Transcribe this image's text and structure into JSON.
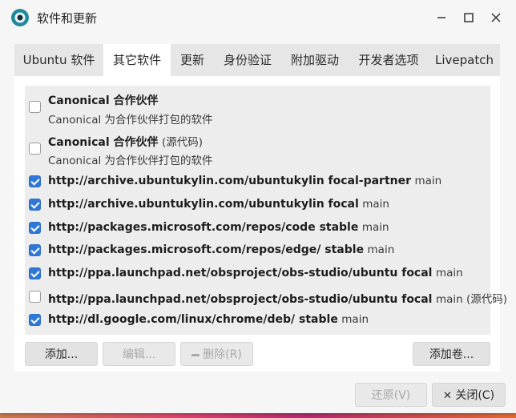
{
  "window": {
    "title": "软件和更新"
  },
  "tabs": [
    {
      "label": "Ubuntu 软件"
    },
    {
      "label": "其它软件"
    },
    {
      "label": "更新"
    },
    {
      "label": "身份验证"
    },
    {
      "label": "附加驱动"
    },
    {
      "label": "开发者选项"
    },
    {
      "label": "Livepatch"
    }
  ],
  "active_tab": "其它软件",
  "sources": [
    {
      "checked": false,
      "title": "Canonical 合作伙伴",
      "suffix": "",
      "subtitle": "Canonical 为合作伙伴打包的软件"
    },
    {
      "checked": false,
      "title": "Canonical 合作伙伴",
      "suffix": "(源代码)",
      "subtitle": "Canonical 为合作伙伴打包的软件"
    },
    {
      "checked": true,
      "title": "http://archive.ubuntukylin.com/ubuntukylin focal-partner",
      "suffix": "main"
    },
    {
      "checked": true,
      "title": "http://archive.ubuntukylin.com/ubuntukylin focal",
      "suffix": "main"
    },
    {
      "checked": true,
      "title": "http://packages.microsoft.com/repos/code stable",
      "suffix": "main"
    },
    {
      "checked": true,
      "title": "http://packages.microsoft.com/repos/edge/ stable",
      "suffix": "main"
    },
    {
      "checked": true,
      "title": "http://ppa.launchpad.net/obsproject/obs-studio/ubuntu focal",
      "suffix": "main"
    },
    {
      "checked": false,
      "title": "http://ppa.launchpad.net/obsproject/obs-studio/ubuntu focal",
      "suffix": "main (源代码)"
    },
    {
      "checked": true,
      "title": "http://dl.google.com/linux/chrome/deb/ stable",
      "suffix": "main"
    }
  ],
  "list_buttons": {
    "add": "添加...",
    "edit": "编辑...",
    "remove": "删除(R)",
    "add_volume": "添加卷..."
  },
  "dialog_buttons": {
    "revert": "还原(V)",
    "close": "关闭(C)"
  },
  "colors": {
    "checkbox_checked": "#2f78d8",
    "app_icon": "#1f8a9a"
  }
}
